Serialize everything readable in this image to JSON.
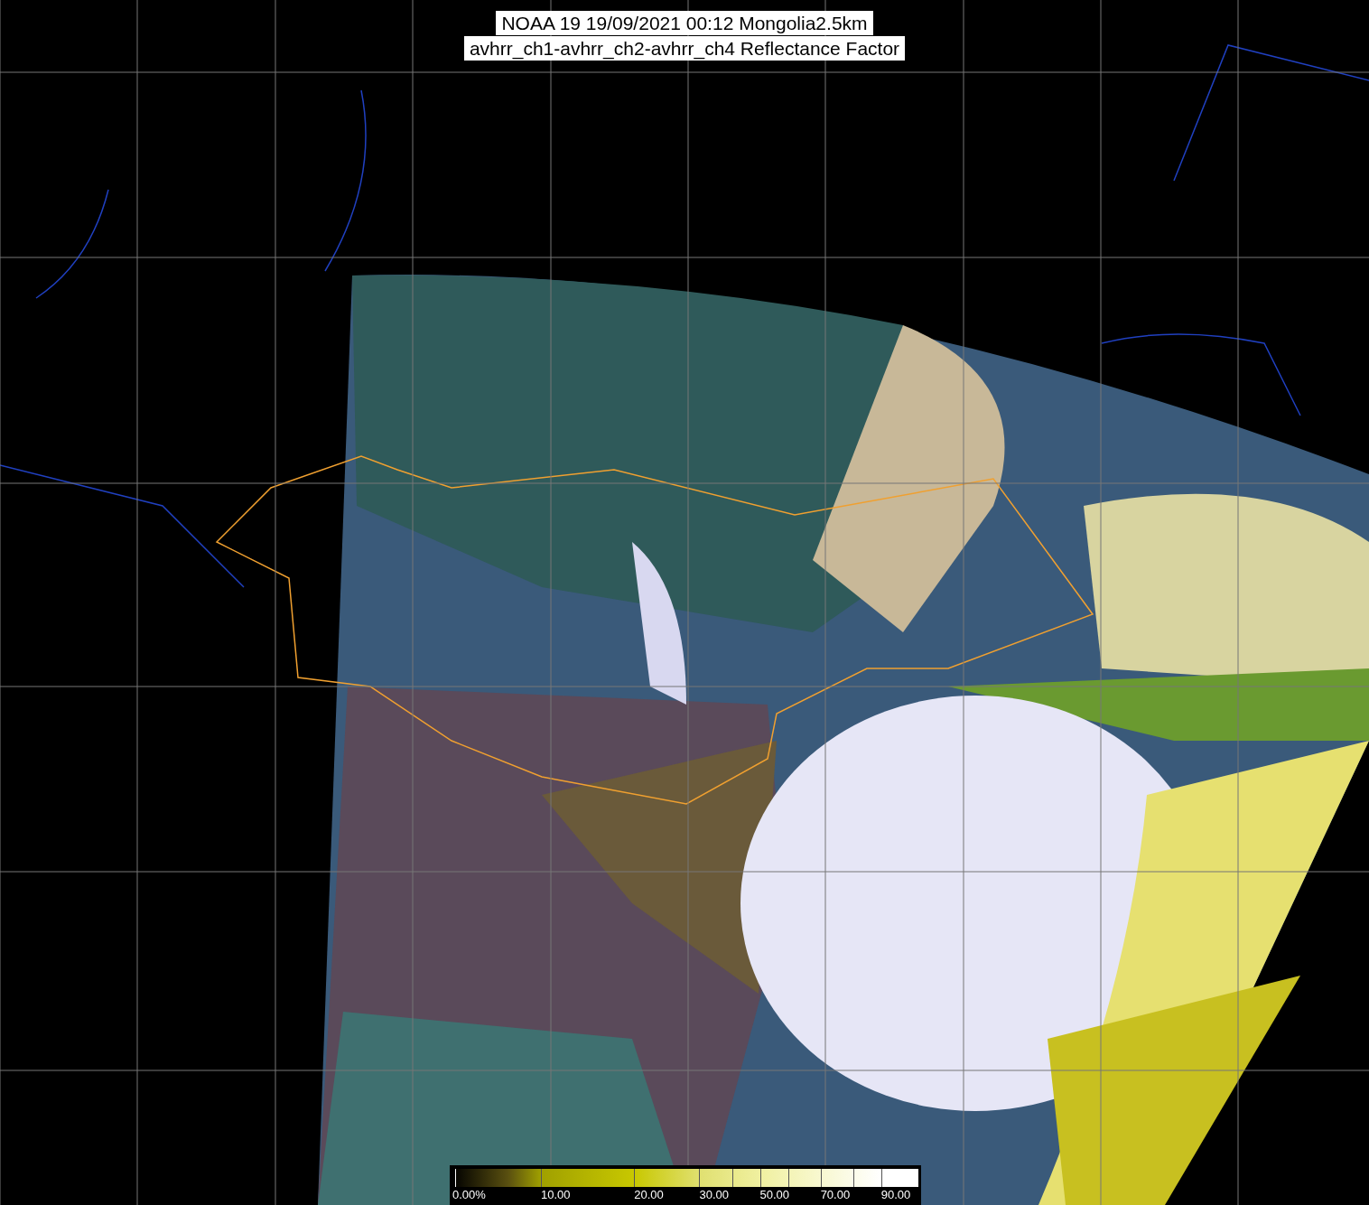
{
  "title": {
    "lines": [
      "NOAA 19 19/09/2021 00:12 Mongolia2.5km",
      "avhrr_ch1-avhrr_ch2-avhrr_ch4 Reflectance Factor"
    ]
  },
  "color_scale": {
    "labels": [
      "0.00%",
      "10.00",
      "20.00",
      "30.00",
      "50.00",
      "70.00",
      "90.00"
    ]
  }
}
